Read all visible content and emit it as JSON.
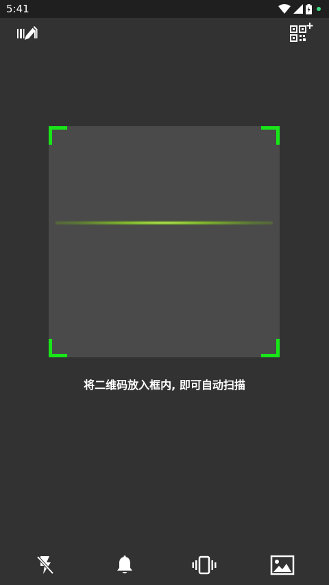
{
  "status_bar": {
    "time": "5:41",
    "icons": [
      "wifi-icon",
      "signal-icon",
      "battery-charging-icon",
      "notification-dot-icon"
    ],
    "dot_color": "#3ddc84"
  },
  "toolbar": {
    "left_icon": "barcode-edit-icon",
    "right_icon": "qr-code-add-icon"
  },
  "scanner": {
    "corner_color": "#19e619",
    "scan_line_color": "#9be028",
    "hint_text": "将二维码放入框内, 即可自动扫描"
  },
  "bottom_bar": {
    "buttons": [
      {
        "icon": "flash-off-icon"
      },
      {
        "icon": "bell-icon"
      },
      {
        "icon": "vibrate-icon"
      },
      {
        "icon": "gallery-icon"
      }
    ]
  }
}
